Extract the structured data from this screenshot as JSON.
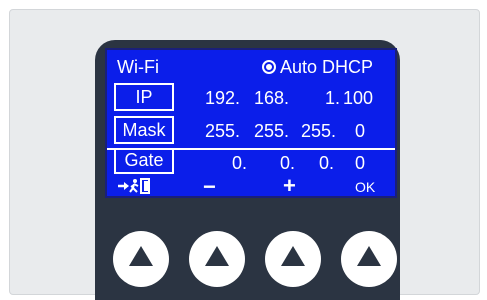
{
  "screen": {
    "title": "Wi-Fi",
    "mode": "Auto DHCP",
    "rows": [
      {
        "label": "IP",
        "values": [
          "192.",
          "168.",
          "1.",
          "100"
        ]
      },
      {
        "label": "Mask",
        "values": [
          "255.",
          "255.",
          "255.",
          "0"
        ]
      },
      {
        "label": "Gate",
        "values": [
          "0.",
          "0.",
          "0.",
          "0"
        ]
      }
    ],
    "softkeys": {
      "exit_icon": "exit-icon",
      "minus": "−",
      "plus": "+",
      "ok": "OK"
    }
  },
  "hardware_buttons": [
    "up-arrow-icon",
    "up-arrow-icon",
    "up-arrow-icon",
    "up-arrow-icon"
  ],
  "colors": {
    "screen_bg": "#0b1eea",
    "bezel": "#2b3442",
    "panel": "#e9ebed"
  }
}
